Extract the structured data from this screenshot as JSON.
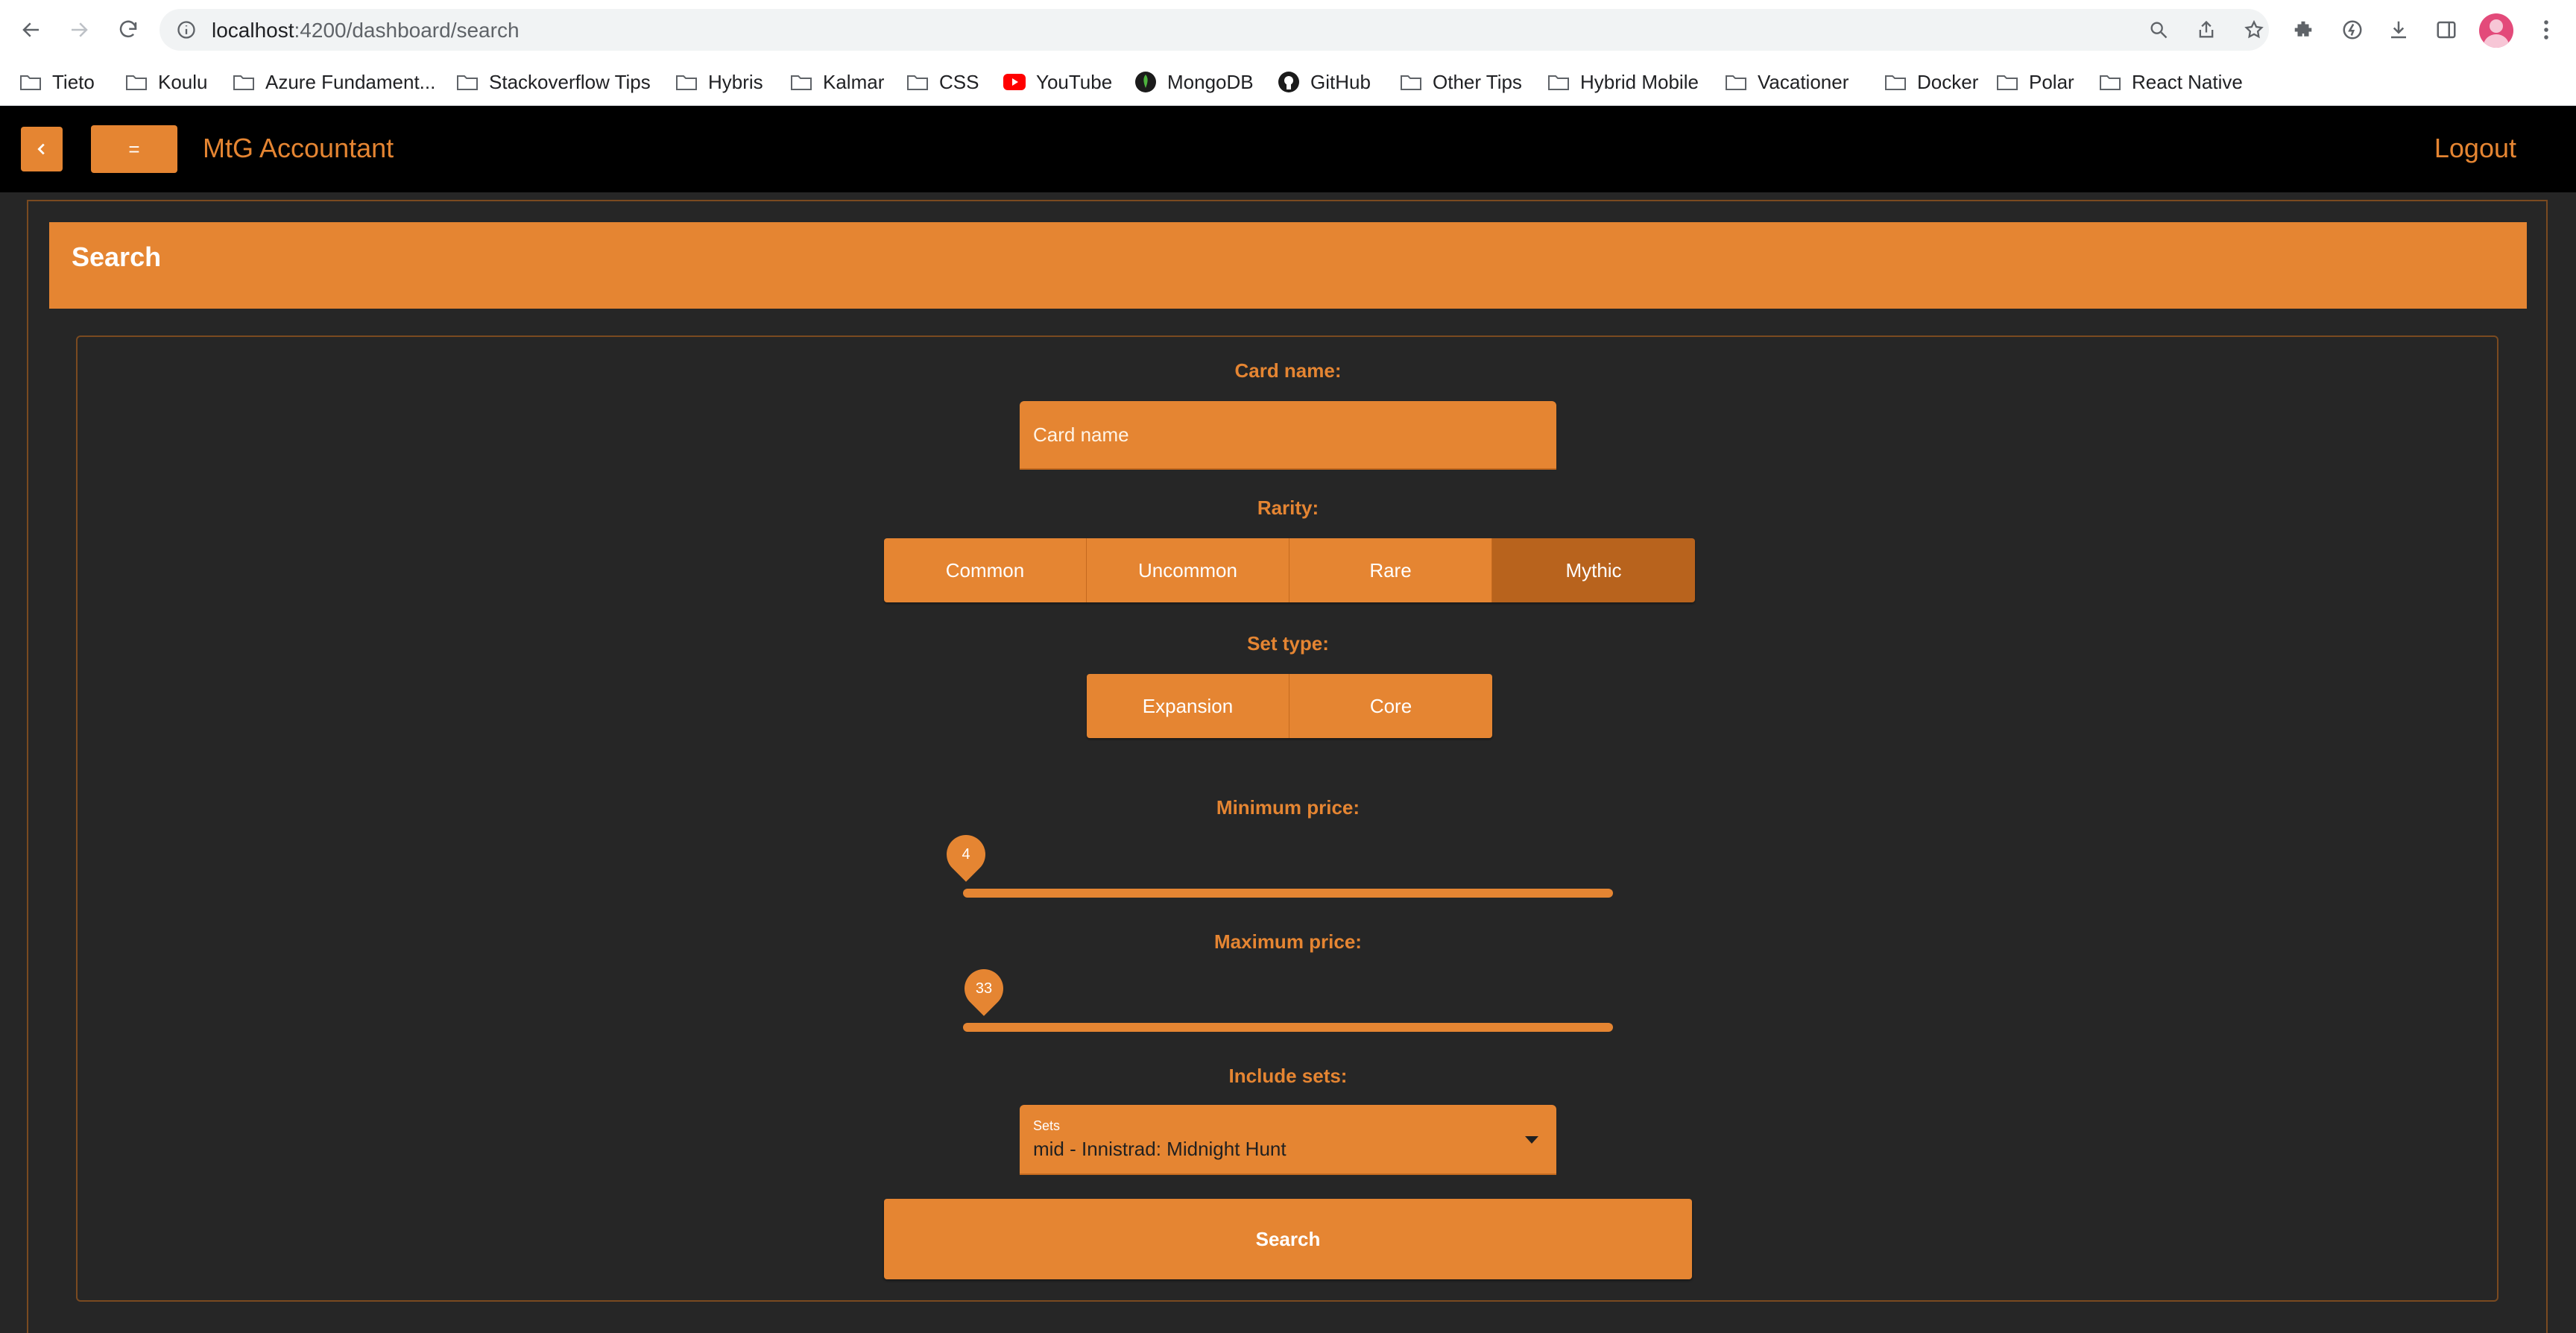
{
  "browser": {
    "url_host": "localhost",
    "url_path": ":4200/dashboard/search",
    "bookmarks": [
      {
        "label": "Tieto",
        "icon": "folder-icon"
      },
      {
        "label": "Koulu",
        "icon": "folder-icon"
      },
      {
        "label": "Azure Fundament...",
        "icon": "folder-icon"
      },
      {
        "label": "Stackoverflow Tips",
        "icon": "folder-icon"
      },
      {
        "label": "Hybris",
        "icon": "folder-icon"
      },
      {
        "label": "Kalmar",
        "icon": "folder-icon"
      },
      {
        "label": "CSS",
        "icon": "folder-icon"
      },
      {
        "label": "YouTube",
        "icon": "youtube-icon"
      },
      {
        "label": "MongoDB",
        "icon": "mongodb-icon"
      },
      {
        "label": "GitHub",
        "icon": "github-icon"
      },
      {
        "label": "Other Tips",
        "icon": "folder-icon"
      },
      {
        "label": "Hybrid Mobile",
        "icon": "folder-icon"
      },
      {
        "label": "Vacationer",
        "icon": "folder-icon"
      },
      {
        "label": "Docker",
        "icon": "folder-icon"
      },
      {
        "label": "Polar",
        "icon": "folder-icon"
      },
      {
        "label": "React Native",
        "icon": "folder-icon"
      }
    ]
  },
  "header": {
    "menu_label": "=",
    "title": "MtG Accountant",
    "logout_label": "Logout"
  },
  "banner": {
    "title": "Search"
  },
  "form": {
    "card_name": {
      "label": "Card name:",
      "placeholder": "Card name",
      "value": ""
    },
    "rarity": {
      "label": "Rarity:",
      "options": [
        "Common",
        "Uncommon",
        "Rare",
        "Mythic"
      ],
      "selected": "Mythic"
    },
    "set_type": {
      "label": "Set type:",
      "options": [
        "Expansion",
        "Core"
      ]
    },
    "min_price": {
      "label": "Minimum price:",
      "value": "4"
    },
    "max_price": {
      "label": "Maximum price:",
      "value": "33"
    },
    "include_sets": {
      "label": "Include sets:",
      "field_label": "Sets",
      "value": "mid - Innistrad: Midnight Hunt"
    },
    "submit_label": "Search"
  },
  "colors": {
    "accent": "#e58532",
    "accent_selected": "#b8631d",
    "background": "#262626",
    "header": "#000000"
  }
}
